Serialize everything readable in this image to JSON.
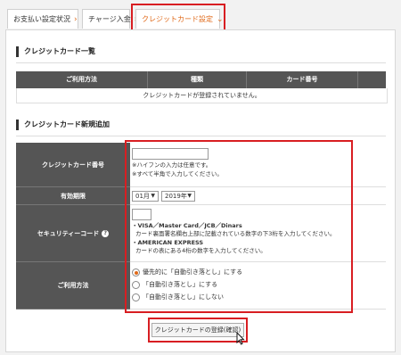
{
  "tabs": [
    {
      "label": "お支払い設定状況",
      "chevron": "›"
    },
    {
      "label": "チャージ入金",
      "chevron": "›"
    },
    {
      "label": "クレジットカード設定",
      "chevron": "⌄"
    }
  ],
  "list_section": {
    "title": "クレジットカード一覧",
    "columns": [
      "ご利用方法",
      "種類",
      "カード番号",
      ""
    ],
    "empty_message": "クレジットカードが登録されていません。"
  },
  "add_section": {
    "title": "クレジットカード新規追加",
    "card_number": {
      "label": "クレジットカード番号",
      "value": "",
      "notes": [
        "※ハイフンの入力は任意です。",
        "※すべて半角で入力してください。"
      ]
    },
    "expiry": {
      "label": "有効期限",
      "month": "01月",
      "year": "2019年"
    },
    "security_code": {
      "label": "セキュリティーコード",
      "help_icon": "?",
      "value": "",
      "lines": [
        "・VISA／Master Card／JCB／Dinars",
        "カード裏面署名欄右上部に記載されている数字の下3桁を入力してください。",
        "・AMERICAN EXPRESS",
        "カードの表にある4桁の数字を入力してください。"
      ]
    },
    "usage": {
      "label": "ご利用方法",
      "options": [
        {
          "label": "優先的に「自動引き落とし」にする",
          "selected": true
        },
        {
          "label": "「自動引き落とし」にする",
          "selected": false
        },
        {
          "label": "「自動引き落とし」にしない",
          "selected": false
        }
      ]
    }
  },
  "submit_label": "クレジットカードの登録(確認)",
  "colors": {
    "accent": "#e06a1a",
    "highlight": "#d81e22",
    "header": "#555555"
  }
}
